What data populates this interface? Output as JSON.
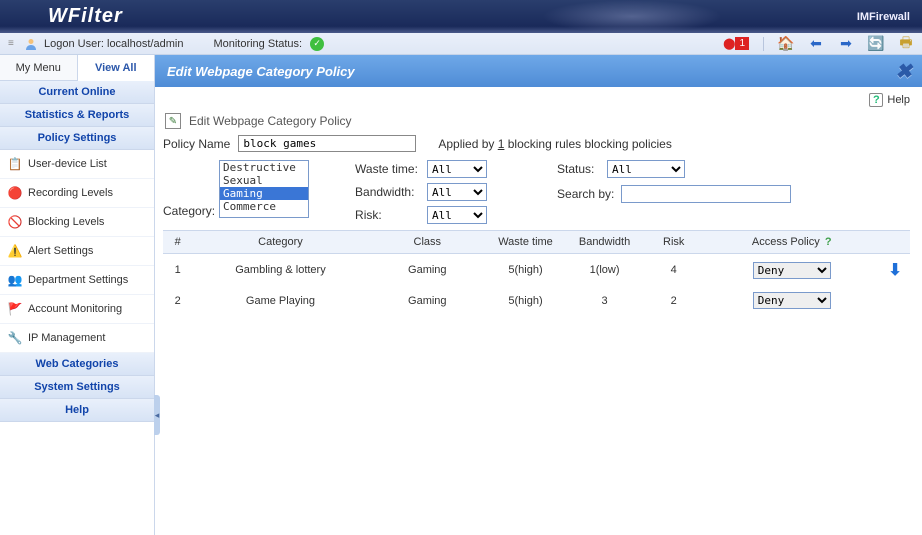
{
  "header": {
    "logo": "WFilter",
    "brand_right": "IMFirewall"
  },
  "toolbar": {
    "logon_label": "Logon User:",
    "logon_value": "localhost/admin",
    "monitoring_label": "Monitoring Status:",
    "status_ok": true,
    "alert_count": "1"
  },
  "sidebar": {
    "tabs": [
      {
        "label": "My Menu",
        "active": false
      },
      {
        "label": "View All",
        "active": true
      }
    ],
    "sections": [
      {
        "type": "header",
        "label": "Current Online"
      },
      {
        "type": "header",
        "label": "Statistics & Reports"
      },
      {
        "type": "header",
        "label": "Policy Settings"
      },
      {
        "type": "item",
        "label": "User-device List",
        "icon": "list"
      },
      {
        "type": "item",
        "label": "Recording Levels",
        "icon": "record"
      },
      {
        "type": "item",
        "label": "Blocking Levels",
        "icon": "block"
      },
      {
        "type": "item",
        "label": "Alert Settings",
        "icon": "alert"
      },
      {
        "type": "item",
        "label": "Department Settings",
        "icon": "dept"
      },
      {
        "type": "item",
        "label": "Account Monitoring",
        "icon": "flag"
      },
      {
        "type": "item",
        "label": "IP Management",
        "icon": "ip"
      },
      {
        "type": "header",
        "label": "Web Categories"
      },
      {
        "type": "header",
        "label": "System Settings"
      },
      {
        "type": "header",
        "label": "Help"
      }
    ]
  },
  "main": {
    "title": "Edit Webpage Category Policy",
    "help_label": "Help",
    "form_title": "Edit Webpage Category Policy",
    "policy_name_label": "Policy Name",
    "policy_name_value": "block games",
    "applied_prefix": "Applied by ",
    "applied_count": "1",
    "applied_suffix": " blocking rules blocking policies",
    "category_label": "Category:",
    "category_options": [
      "Destructive",
      "Sexual",
      "Gaming",
      "Commerce"
    ],
    "category_selected": "Gaming",
    "filters": {
      "waste_label": "Waste time:",
      "waste_value": "All",
      "bandwidth_label": "Bandwidth:",
      "bandwidth_value": "All",
      "risk_label": "Risk:",
      "risk_value": "All",
      "status_label": "Status:",
      "status_value": "All",
      "search_label": "Search by:",
      "search_value": ""
    },
    "table": {
      "headers": [
        "#",
        "Category",
        "Class",
        "Waste time",
        "Bandwidth",
        "Risk",
        "Access Policy",
        ""
      ],
      "rows": [
        {
          "n": "1",
          "category": "Gambling & lottery",
          "cls": "Gaming",
          "waste": "5(high)",
          "bw": "1(low)",
          "risk": "4",
          "policy": "Deny"
        },
        {
          "n": "2",
          "category": "Game Playing",
          "cls": "Gaming",
          "waste": "5(high)",
          "bw": "3",
          "risk": "2",
          "policy": "Deny"
        }
      ]
    }
  }
}
